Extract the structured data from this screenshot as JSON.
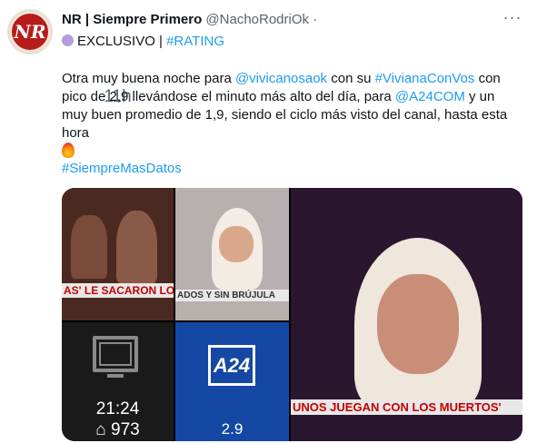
{
  "tweet": {
    "avatar_text": "NR",
    "author_name": "NR | Siempre Primero",
    "handle": "@NachoRodriOk",
    "separator": "·",
    "time": "11h",
    "more_icon": "···",
    "tag_exclusive": "EXCLUSIVO | ",
    "tag_rating": "#RATING",
    "text_1": "Otra muy buena noche para ",
    "mention_1": "@vivicanosaok",
    "text_2": " con su ",
    "hashtag_1": "#VivianaConVos",
    "text_3": " con pico de 2,9 llevándose el minuto más alto del día, para ",
    "mention_2": "@A24COM",
    "text_4": " y un muy buen promedio de 1,9, siendo el ciclo más visto del canal, hasta esta hora",
    "hashtag_2": "#SiempreMasDatos"
  },
  "media": {
    "chyron_1": "AS' LE SACARON LOS MUEBLES A LA",
    "chyron_2": "ADOS Y SIN BRÚJULA",
    "chyron_3": "UNOS JUEGAN CON LOS MUERTOS'",
    "clock": "21:24",
    "views": "973",
    "channel_logo": "A24",
    "rating": "2.9"
  },
  "colors": {
    "link": "#1d9bf0",
    "muted": "#536471"
  }
}
